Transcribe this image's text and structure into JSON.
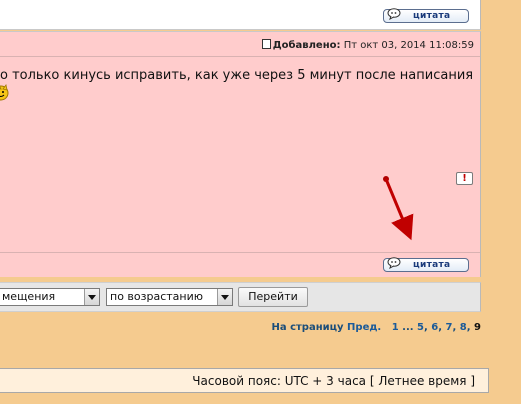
{
  "prev_post": {
    "quote_label": "цитата"
  },
  "post": {
    "added_label": "Добавлено:",
    "added_date": "Пт окт 03, 2014 11:08:59",
    "text": "о только кинусь исправить, как уже через 5 минут после написания",
    "report_symbol": "!",
    "quote_label": "цитата"
  },
  "sort_bar": {
    "sort_field_value": "мещения",
    "sort_order_value": "по возрастанию",
    "go_label": "Перейти"
  },
  "pagination": {
    "label": "На страницу",
    "prev_label": "Пред.",
    "first": "1",
    "ellipsis": "...",
    "pages": [
      "5",
      "6",
      "7",
      "8"
    ],
    "current": "9"
  },
  "footer": {
    "timezone": "Часовой пояс: UTC + 3 часа [ Летнее время ]"
  },
  "colors": {
    "background": "#f5cb8f",
    "post_bg": "#ffcccc",
    "link": "#1a5a99",
    "annotation_arrow": "#cc0000"
  }
}
